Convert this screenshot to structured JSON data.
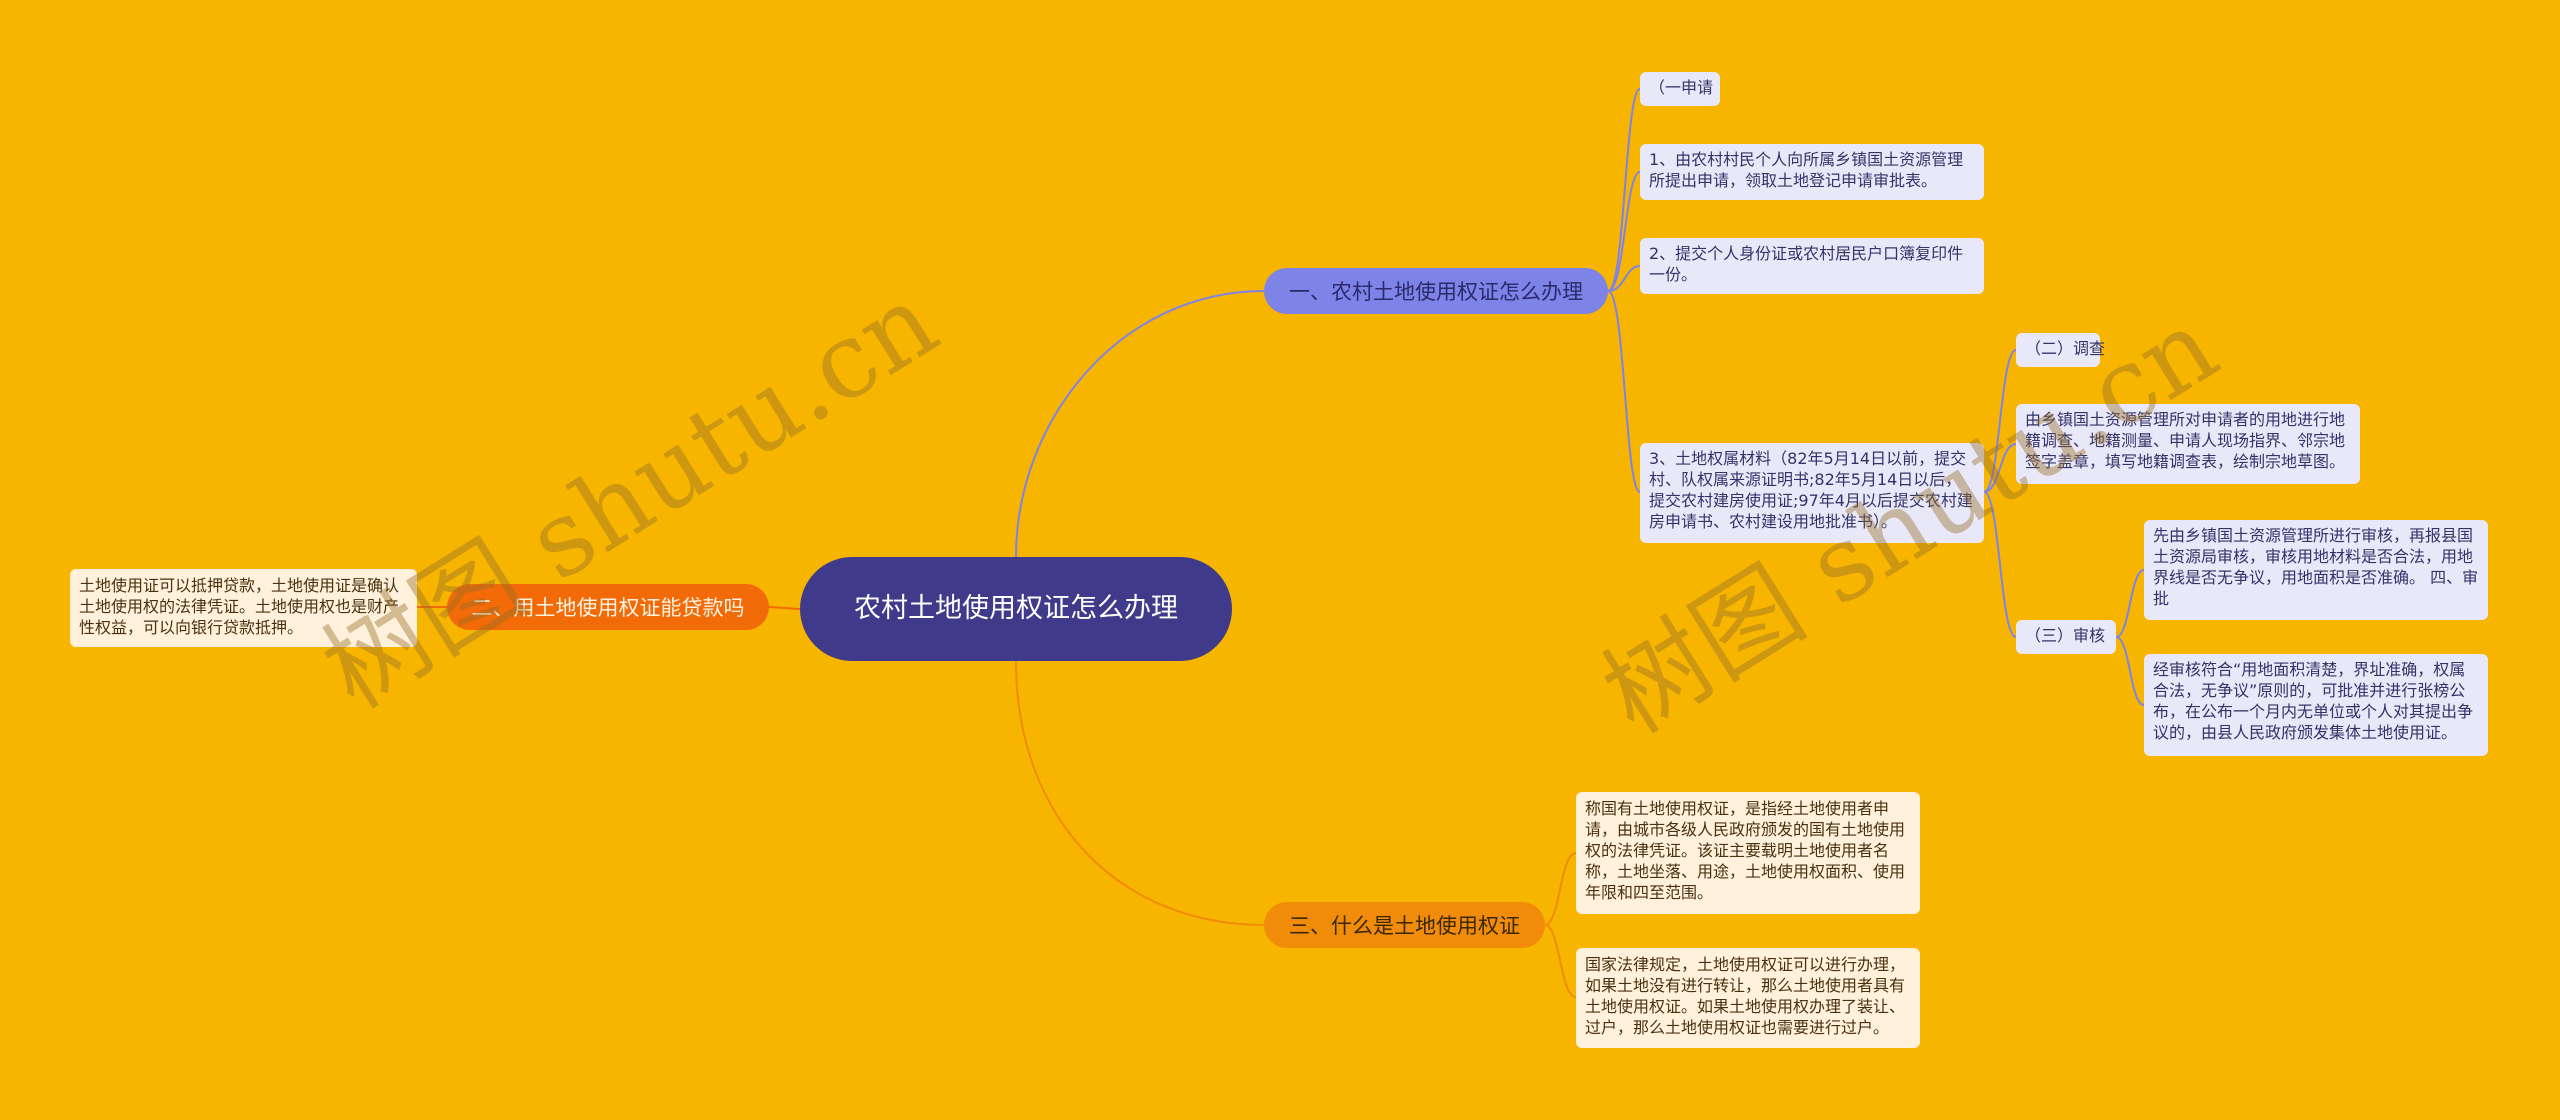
{
  "center": {
    "label": "农村土地使用权证怎么办理"
  },
  "branches": {
    "b1": "一、农村土地使用权证怎么办理",
    "b2": "二、用土地使用权证能贷款吗",
    "b3": "三、什么是土地使用权证"
  },
  "leaves": {
    "apply": "（一申请",
    "step1": "1、由农村村民个人向所属乡镇国土资源管理所提出申请，领取土地登记申请审批表。",
    "step2": "2、提交个人身份证或农村居民户口簿复印件一份。",
    "step3": "3、土地权属材料（82年5月14日以前，提交村、队权属来源证明书;82年5月14日以后，提交农村建房使用证;97年4月以后提交农村建房申请书、农村建设用地批准书）。",
    "survey": "（二）调查",
    "survey_text": "由乡镇国土资源管理所对申请者的用地进行地籍调查、地籍测量、申请人现场指界、邻宗地签字盖章，填写地籍调查表，绘制宗地草图。",
    "review": "（三）审核",
    "review_text1": "先由乡镇国土资源管理所进行审核，再报县国土资源局审核，审核用地材料是否合法，用地界线是否无争议，用地面积是否准确。 四、审批",
    "review_text2": "经审核符合“用地面积清楚，界址准确，权属合法，无争议”原则的，可批准并进行张榜公布，在公布一个月内无单位或个人对其提出争议的，由县人民政府颁发集体土地使用证。",
    "loan": "土地使用证可以抵押贷款，土地使用证是确认土地使用权的法律凭证。土地使用权也是财产性权益，可以向银行贷款抵押。",
    "def1": "称国有土地使用权证，是指经土地使用者申请，由城市各级人民政府颁发的国有土地使用权的法律凭证。该证主要载明土地使用者名称，土地坐落、用途，土地使用权面积、使用年限和四至范围。",
    "def2": "国家法律规定，土地使用权证可以进行办理，如果土地没有进行转让，那么土地使用者具有土地使用权证。如果土地使用权办理了装让、过户，那么土地使用权证也需要进行过户。"
  },
  "watermarks": [
    "树图 shutu.cn",
    "树图 shutu.cn"
  ],
  "colors": {
    "background": "#F7B500",
    "center": "#3F3A8A",
    "branch_purple": "#7E83E8",
    "branch_orange_red": "#F26B08",
    "branch_orange": "#F08C09",
    "leaf_purple": "#E9E8F8",
    "leaf_orange": "#FFF1DB"
  }
}
